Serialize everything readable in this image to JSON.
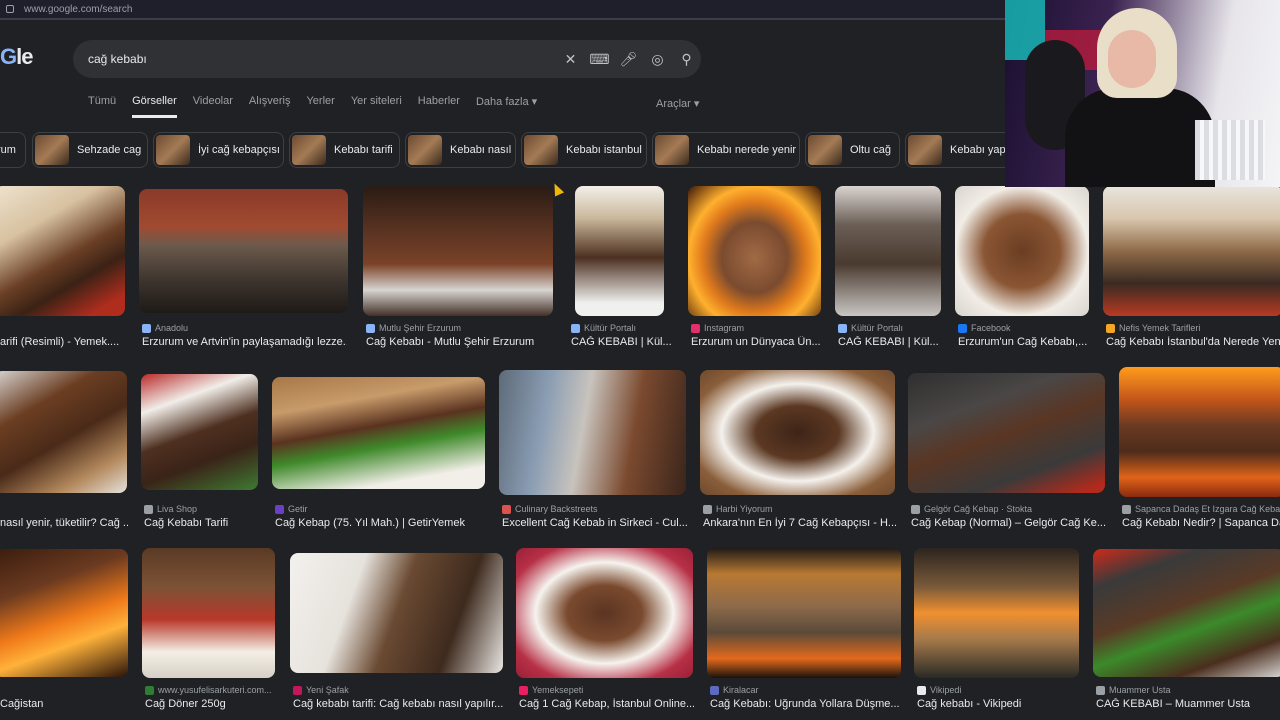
{
  "browser": {
    "url": "www.google.com/search"
  },
  "logo": {
    "text_b": "G",
    "text_rest": "le"
  },
  "search": {
    "query": "cağ kebabı"
  },
  "tabs": [
    "Tümü",
    "Görseller",
    "Videolar",
    "Alışveriş",
    "Yerler",
    "Yer siteleri",
    "Haberler",
    "Daha fazla ▾"
  ],
  "tools_label": "Araçlar ▾",
  "chips": [
    "rum",
    "Sehzade cag",
    "İyi cağ kebapçısı",
    "Kebabı tarifi",
    "Kebabı nasıl",
    "Kebabı istanbul",
    "Kebabı nerede yenir",
    "Oltu cağ",
    "Kebabı yapı"
  ],
  "row1": [
    {
      "source": "",
      "title": "arifi (Resimli) - Yemek...."
    },
    {
      "source": "Anadolu",
      "title": "Erzurum ve Artvin'in paylaşamadığı lezze..."
    },
    {
      "source": "Mutlu Şehir Erzurum",
      "title": "Cağ Kebabı - Mutlu Şehir Erzurum"
    },
    {
      "source": "Kültür Portalı",
      "title": "CAĞ KEBABI | Kül..."
    },
    {
      "source": "Instagram",
      "title": "Erzurum un Dünyaca Ün..."
    },
    {
      "source": "Kültür Portalı",
      "title": "CAĞ KEBABI | Kül..."
    },
    {
      "source": "Facebook",
      "title": "Erzurum'un Cağ Kebabı,..."
    },
    {
      "source": "Nefis Yemek Tarifleri",
      "title": "Cağ Kebabı İstanbul'da Nerede Yenir"
    }
  ],
  "row2": [
    {
      "source": "",
      "title": "nasıl yenir, tüketilir? Cağ ..."
    },
    {
      "source": "Liva Shop",
      "title": "Cağ Kebabı Tarifi"
    },
    {
      "source": "Getir",
      "title": "Cağ Kebap (75. Yıl Mah.) | GetirYemek"
    },
    {
      "source": "Culinary Backstreets",
      "title": "Excellent Cağ Kebab in Sirkeci - Cul..."
    },
    {
      "source": "Harbi Yiyorum",
      "title": "Ankara'nın En İyi 7 Cağ Kebapçısı - H..."
    },
    {
      "source": "Gelgör Cağ Kebap · Stokta",
      "title": "Cağ Kebap (Normal) – Gelgör Cağ Ke..."
    },
    {
      "source": "Sapanca Dadaş Et Izgara Cağ Kebap",
      "title": "Cağ Kebabı Nedir? | Sapanca Da..."
    }
  ],
  "row3": [
    {
      "source": "",
      "title": "Cağistan"
    },
    {
      "source": "www.yusufelisarkuteri.com...",
      "title": "Cağ Döner 250g"
    },
    {
      "source": "Yeni Şafak",
      "title": "Cağ kebabı tarifi: Cağ kebabı nasıl yapılır..."
    },
    {
      "source": "Yemeksepeti",
      "title": "Cağ 1 Cağ Kebap, İstanbul Online..."
    },
    {
      "source": "Kiralacar",
      "title": "Cağ Kebabı: Uğrunda Yollara Düşme..."
    },
    {
      "source": "Vikipedi",
      "title": "Cağ kebabı - Vikipedi"
    },
    {
      "source": "Muammer Usta",
      "title": "CAĞ KEBABI – Muammer Usta"
    }
  ]
}
